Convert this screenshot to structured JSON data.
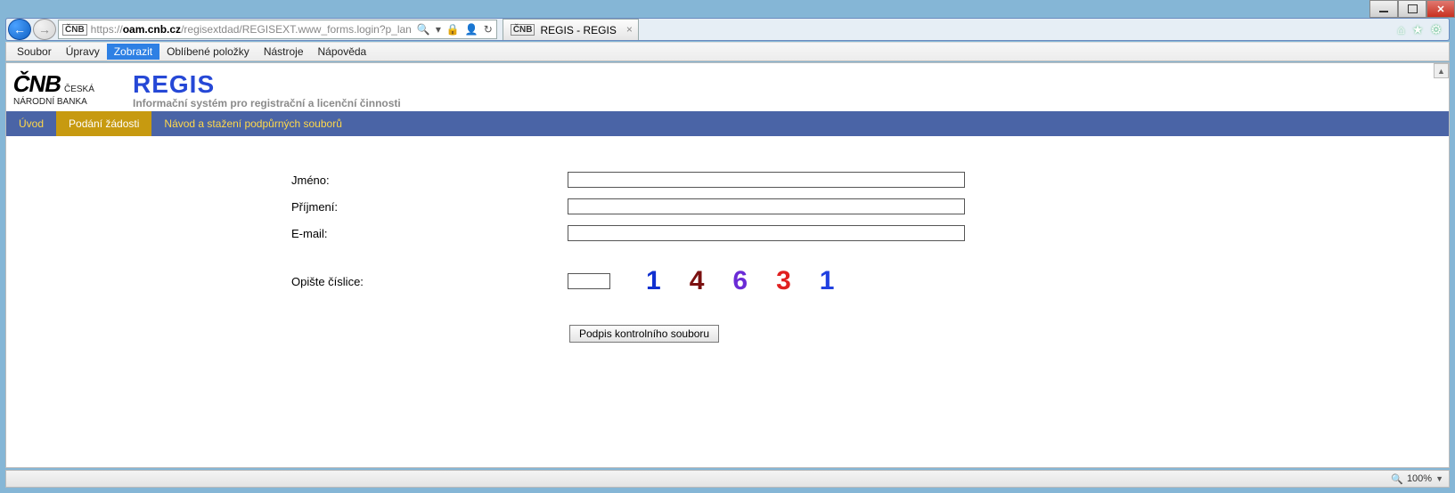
{
  "window": {
    "min_label": "",
    "max_label": "",
    "close_label": ""
  },
  "addressbar": {
    "site_badge": "ČNB",
    "url_host": "oam.cnb.cz",
    "url_prefix": "https://",
    "url_rest": "/regisextdad/REGISEXT.www_forms.login?p_lan",
    "search_glyph": "🔍",
    "lock_glyph": "🔒",
    "ident_glyph": "▾",
    "refresh_glyph": "↻"
  },
  "tab": {
    "site_badge": "ČNB",
    "title": "REGIS - REGIS",
    "close_glyph": "×"
  },
  "ie_toolbar": {
    "home": "⌂",
    "fav": "★",
    "tools": "⚙"
  },
  "browser_menu": {
    "items": [
      "Soubor",
      "Úpravy",
      "Zobrazit",
      "Oblíbené položky",
      "Nástroje",
      "Nápověda"
    ],
    "active_index": 2
  },
  "logo": {
    "bank_big": "ČNB",
    "bank_line1": "ČESKÁ",
    "bank_line2": "NÁRODNÍ BANKA"
  },
  "header": {
    "title": "REGIS",
    "subtitle": "Informační systém pro registrační a licenční činnosti"
  },
  "nav": {
    "items": [
      "Úvod",
      "Podání žádosti",
      "Návod a stažení podpůrných souborů"
    ],
    "active_index": 1
  },
  "form": {
    "labels": {
      "firstname": "Jméno:",
      "lastname": "Příjmení:",
      "email": "E-mail:",
      "captcha": "Opište číslice:"
    },
    "values": {
      "firstname": "",
      "lastname": "",
      "email": "",
      "captcha_input": ""
    },
    "captcha_digits": [
      "1",
      "4",
      "6",
      "3",
      "1"
    ],
    "submit_label": "Podpis kontrolního souboru"
  },
  "statusbar": {
    "zoom": "100%"
  }
}
